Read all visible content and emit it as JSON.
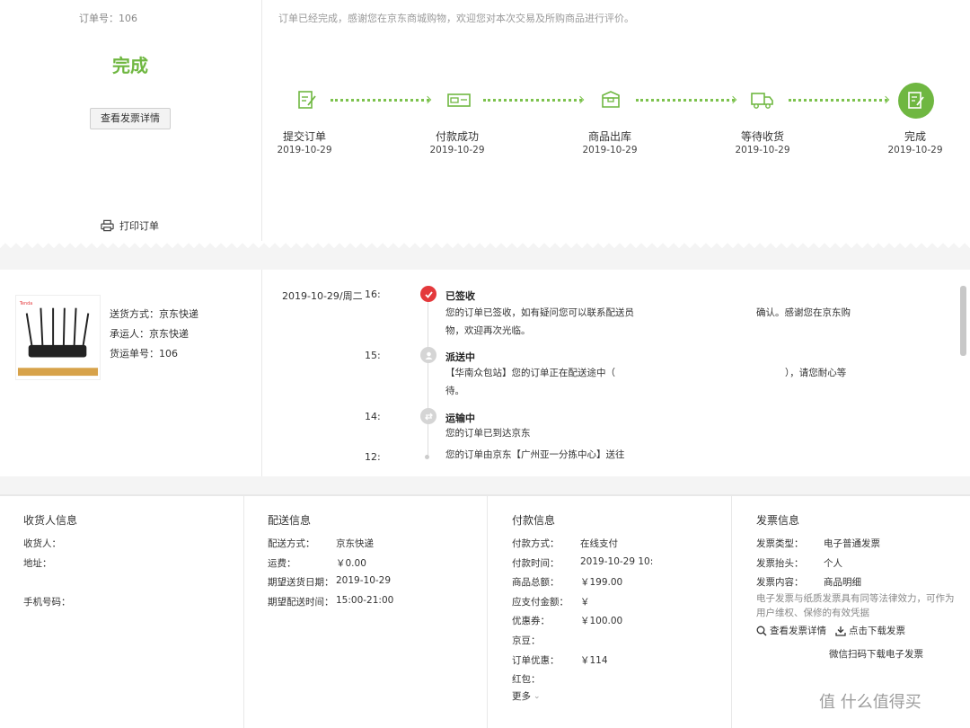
{
  "order": {
    "order_no": "订单号：106",
    "status": "完成",
    "invoice_button": "查看发票详情",
    "print_label": "打印订单",
    "message": "订单已经完成，感谢您在京东商城购物，欢迎您对本次交易及所购商品进行评价。"
  },
  "steps": [
    {
      "label": "提交订单",
      "date": "2019-10-29",
      "icon": "order-edit-icon"
    },
    {
      "label": "付款成功",
      "date": "2019-10-29",
      "icon": "payment-icon"
    },
    {
      "label": "商品出库",
      "date": "2019-10-29",
      "icon": "package-icon"
    },
    {
      "label": "等待收货",
      "date": "2019-10-29",
      "icon": "truck-icon"
    },
    {
      "label": "完成",
      "date": "2019-10-29",
      "icon": "complete-icon"
    }
  ],
  "shipping": {
    "method": "送货方式：京东快递",
    "carrier": "承运人：京东快递",
    "tracking_no": "货运单号：106"
  },
  "tracking": {
    "date": "2019-10-29/周二",
    "events": [
      {
        "time": "16:",
        "title": "已签收",
        "line1": "您的订单已签收，如有疑问您可以联系配送员",
        "line1b": "确认。感谢您在京东购",
        "line2": "物，欢迎再次光临。"
      },
      {
        "time": "15:",
        "title": "派送中",
        "line1": "【华南众包站】您的订单正在配送途中（",
        "line1b": "），请您耐心等",
        "line2": "待。"
      },
      {
        "time": "14:",
        "title": "运输中",
        "line1": "您的订单已到达京东",
        "line2": ""
      },
      {
        "time": "12:",
        "title": "",
        "line1": "您的订单由京东【广州亚一分拣中心】送往",
        "line2": ""
      }
    ]
  },
  "receiver": {
    "title": "收货人信息",
    "name_key": "收货人：",
    "address_key": "地址：",
    "phone_key": "手机号码："
  },
  "delivery": {
    "title": "配送信息",
    "rows": [
      {
        "key": "配送方式：",
        "value": "京东快递"
      },
      {
        "key": "运费：",
        "value": "￥0.00"
      },
      {
        "key": "期望送货日期：",
        "value": "2019-10-29"
      },
      {
        "key": "期望配送时间：",
        "value": "15:00-21:00"
      }
    ]
  },
  "payment": {
    "title": "付款信息",
    "rows": [
      {
        "key": "付款方式：",
        "value": "在线支付"
      },
      {
        "key": "付款时间：",
        "value": "2019-10-29 10:"
      },
      {
        "key": "商品总额：",
        "value": "￥199.00"
      },
      {
        "key": "应支付金额：",
        "value": "￥"
      },
      {
        "key": "优惠券：",
        "value": "￥100.00"
      },
      {
        "key": "京豆：",
        "value": ""
      },
      {
        "key": "订单优惠：",
        "value": "￥114"
      },
      {
        "key": "红包：",
        "value": ""
      }
    ],
    "more": "更多"
  },
  "invoice": {
    "title": "发票信息",
    "rows": [
      {
        "key": "发票类型：",
        "value": "电子普通发票"
      },
      {
        "key": "发票抬头：",
        "value": "个人"
      },
      {
        "key": "发票内容：",
        "value": "商品明细"
      }
    ],
    "note_line1": "电子发票与纸质发票具有同等法律效力，可作为",
    "note_line2": "用户维权、保修的有效凭据",
    "view_link": "查看发票详情",
    "download_link": "点击下载发票",
    "wechat": "微信扫码下载电子发票"
  },
  "watermark": "值 什么值得买",
  "colors": {
    "accent": "#6fb741",
    "red": "#e4393c"
  }
}
